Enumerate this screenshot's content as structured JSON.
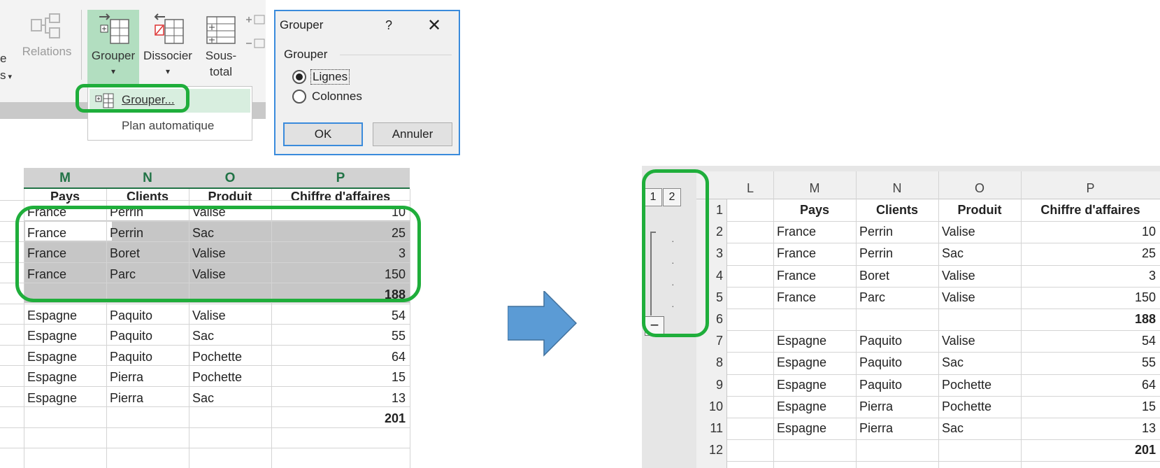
{
  "ribbon": {
    "partial_left_label_1": "e",
    "partial_left_label_2": "s",
    "relations_label": "Relations",
    "grouper_label": "Grouper",
    "dissocier_label": "Dissocier",
    "soustotal_label_1": "Sous-",
    "soustotal_label_2": "total",
    "dropdown_items": [
      "Grouper...",
      "Plan automatique"
    ]
  },
  "dialog": {
    "title": "Grouper",
    "help": "?",
    "close": "✕",
    "group_label": "Grouper",
    "options": [
      "Lignes",
      "Colonnes"
    ],
    "selected": "Lignes",
    "ok": "OK",
    "cancel": "Annuler"
  },
  "left_sheet": {
    "columns": [
      "M",
      "N",
      "O",
      "P"
    ],
    "headers": [
      "Pays",
      "Clients",
      "Produit",
      "Chiffre d'affaires"
    ],
    "rows": [
      [
        "France",
        "Perrin",
        "Valise",
        "10"
      ],
      [
        "France",
        "Perrin",
        "Sac",
        "25"
      ],
      [
        "France",
        "Boret",
        "Valise",
        "3"
      ],
      [
        "France",
        "Parc",
        "Valise",
        "150"
      ],
      [
        "",
        "",
        "",
        "188"
      ],
      [
        "Espagne",
        "Paquito",
        "Valise",
        "54"
      ],
      [
        "Espagne",
        "Paquito",
        "Sac",
        "55"
      ],
      [
        "Espagne",
        "Paquito",
        "Pochette",
        "64"
      ],
      [
        "Espagne",
        "Pierra",
        "Pochette",
        "15"
      ],
      [
        "Espagne",
        "Pierra",
        "Sac",
        "13"
      ],
      [
        "",
        "",
        "",
        "201"
      ]
    ]
  },
  "right_sheet": {
    "outline_levels": [
      "1",
      "2"
    ],
    "collapse_symbol": "−",
    "columns": [
      "L",
      "M",
      "N",
      "O",
      "P"
    ],
    "row_numbers": [
      "1",
      "2",
      "3",
      "4",
      "5",
      "6",
      "7",
      "8",
      "9",
      "10",
      "11",
      "12"
    ],
    "headers": [
      "Pays",
      "Clients",
      "Produit",
      "Chiffre d'affaires"
    ],
    "rows": [
      [
        "France",
        "Perrin",
        "Valise",
        "10"
      ],
      [
        "France",
        "Perrin",
        "Sac",
        "25"
      ],
      [
        "France",
        "Boret",
        "Valise",
        "3"
      ],
      [
        "France",
        "Parc",
        "Valise",
        "150"
      ],
      [
        "",
        "",
        "",
        "188"
      ],
      [
        "Espagne",
        "Paquito",
        "Valise",
        "54"
      ],
      [
        "Espagne",
        "Paquito",
        "Sac",
        "55"
      ],
      [
        "Espagne",
        "Paquito",
        "Pochette",
        "64"
      ],
      [
        "Espagne",
        "Pierra",
        "Pochette",
        "15"
      ],
      [
        "Espagne",
        "Pierra",
        "Sac",
        "13"
      ],
      [
        "",
        "",
        "",
        "201"
      ]
    ]
  },
  "colors": {
    "highlight_green": "#1fae3b",
    "excel_green": "#217346",
    "arrow_blue": "#5b9bd5",
    "dialog_border": "#3a8bdc"
  }
}
